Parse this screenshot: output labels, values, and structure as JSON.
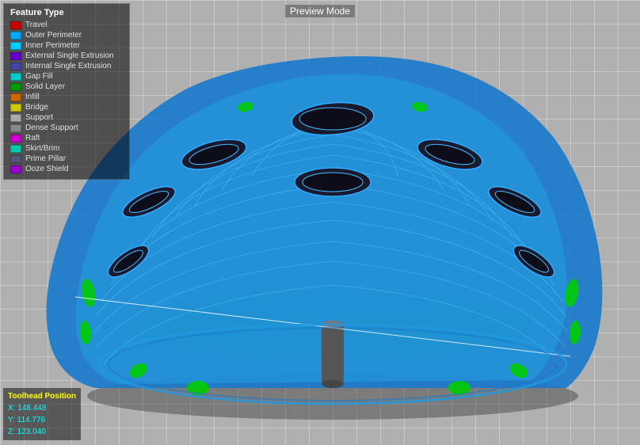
{
  "header": {
    "preview_mode_label": "Preview Mode"
  },
  "legend": {
    "title": "Feature Type",
    "items": [
      {
        "label": "Travel",
        "color": "#cc0000"
      },
      {
        "label": "Outer Perimeter",
        "color": "#00aaff"
      },
      {
        "label": "Inner Perimeter",
        "color": "#00ccff"
      },
      {
        "label": "External Single Extrusion",
        "color": "#6600cc"
      },
      {
        "label": "Internal Single Extrusion",
        "color": "#4444aa"
      },
      {
        "label": "Gap Fill",
        "color": "#00cccc"
      },
      {
        "label": "Solid Layer",
        "color": "#009900"
      },
      {
        "label": "Infill",
        "color": "#cc6600"
      },
      {
        "label": "Bridge",
        "color": "#cccc00"
      },
      {
        "label": "Support",
        "color": "#aaaaaa"
      },
      {
        "label": "Dense Support",
        "color": "#888888"
      },
      {
        "label": "Raft",
        "color": "#cc00cc"
      },
      {
        "label": "Skirt/Brim",
        "color": "#00ccaa"
      },
      {
        "label": "Prime Pillar",
        "color": "#555577"
      },
      {
        "label": "Ooze Shield",
        "color": "#9900cc"
      }
    ]
  },
  "toolhead": {
    "title": "Toolhead Position",
    "x_label": "X:",
    "x_value": "148.448",
    "y_label": "Y:",
    "y_value": "114.776",
    "z_label": "Z:",
    "z_value": "123.040"
  }
}
